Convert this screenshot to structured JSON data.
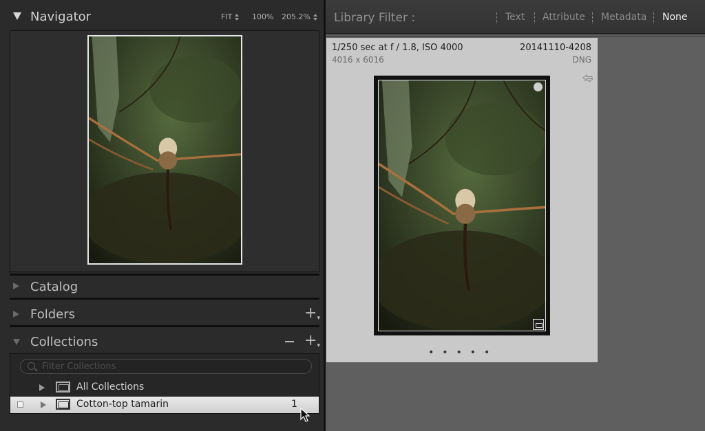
{
  "navigator": {
    "title": "Navigator",
    "zoom_options": [
      "FIT",
      "100%",
      "205.2%"
    ]
  },
  "panels": {
    "catalog": "Catalog",
    "folders": "Folders",
    "collections": "Collections"
  },
  "collections": {
    "filter_placeholder": "Filter Collections",
    "items": [
      {
        "name": "All Collections",
        "count": ""
      },
      {
        "name": "Cotton-top tamarin",
        "count": "1"
      }
    ]
  },
  "library_filter": {
    "label": "Library Filter :",
    "options": [
      "Text",
      "Attribute",
      "Metadata",
      "None"
    ],
    "active": "None"
  },
  "photo": {
    "exposure": "1/250 sec at f / 1.8, ISO 4000",
    "filename": "20141110-4208",
    "dimensions": "4016 x 6016",
    "file_type": "DNG",
    "dots": "•••••"
  },
  "icons": {
    "navigator_toggle": "disclosure-triangle-down-icon",
    "add": "plus-icon",
    "remove": "minus-icon",
    "search": "magnifier-icon",
    "collection": "collection-icon",
    "rotate": "rotate-arrows-icon",
    "cursor": "mouse-pointer-icon"
  }
}
